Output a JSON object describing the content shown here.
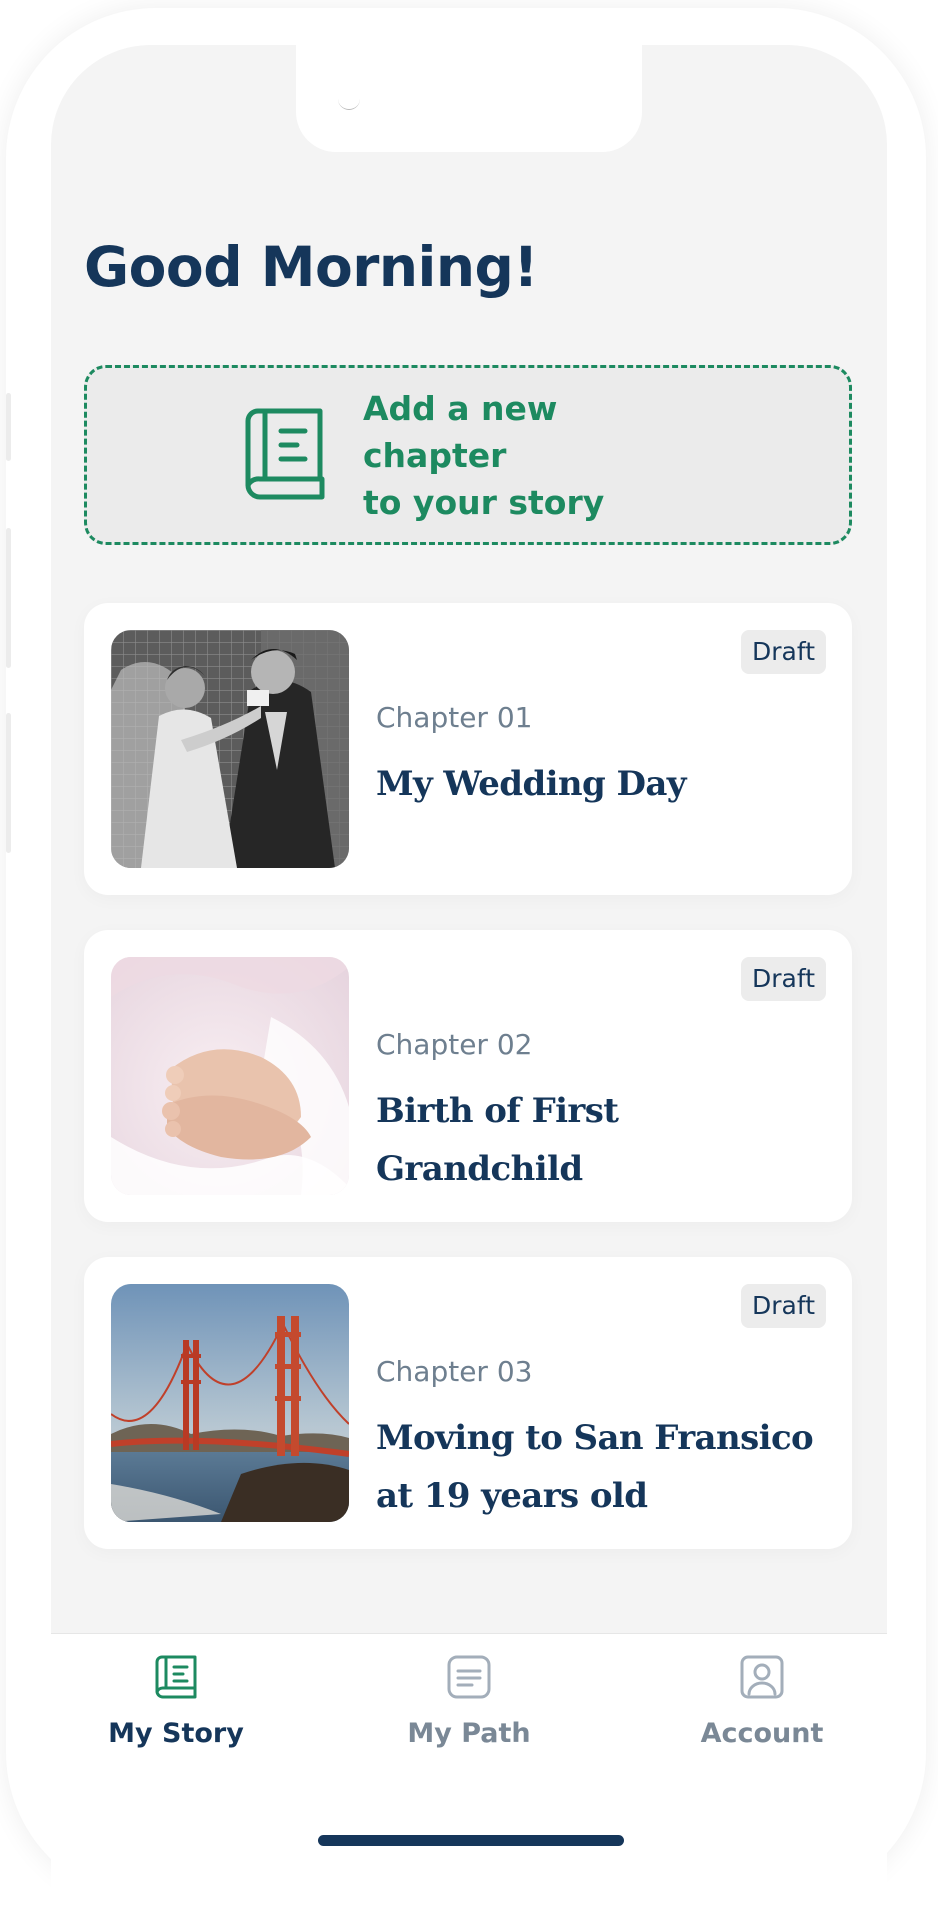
{
  "greeting": "Good Morning!",
  "add_chapter": {
    "line1": "Add a new chapter",
    "line2": "to your story"
  },
  "chapters": [
    {
      "badge": "Draft",
      "number": "Chapter 01",
      "title_line1": "My Wedding Day",
      "title_line2": ""
    },
    {
      "badge": "Draft",
      "number": "Chapter 02",
      "title_line1": "Birth of First Grandchild",
      "title_line2": ""
    },
    {
      "badge": "Draft",
      "number": "Chapter 03",
      "title_line1": "Moving to San Fransico",
      "title_line2": "at 19 years old"
    }
  ],
  "tabs": [
    {
      "label": "My Story",
      "icon": "book-icon",
      "active": true
    },
    {
      "label": "My Path",
      "icon": "document-icon",
      "active": false
    },
    {
      "label": "Account",
      "icon": "user-icon",
      "active": false
    }
  ],
  "colors": {
    "primary": "#15365a",
    "accent": "#1d8a60",
    "muted": "#6e7f8f",
    "background": "#f4f4f4"
  }
}
